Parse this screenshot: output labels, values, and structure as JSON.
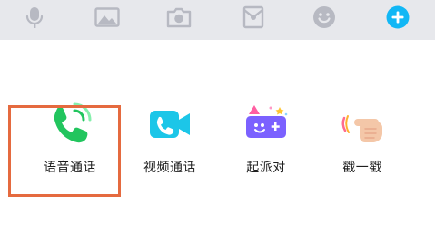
{
  "toolbar": {
    "items": [
      {
        "icon": "microphone-icon"
      },
      {
        "icon": "image-icon"
      },
      {
        "icon": "camera-icon"
      },
      {
        "icon": "red-packet-icon"
      },
      {
        "icon": "emoji-icon"
      },
      {
        "icon": "plus-icon"
      }
    ],
    "accent": "#12b7f5"
  },
  "apps": [
    {
      "label": "语音通话",
      "icon": "voice-call-icon",
      "selected": true
    },
    {
      "label": "视频通话",
      "icon": "video-call-icon",
      "selected": false
    },
    {
      "label": "起派对",
      "icon": "party-game-icon",
      "selected": false
    },
    {
      "label": "戳一戳",
      "icon": "poke-icon",
      "selected": false
    }
  ],
  "colors": {
    "highlight": "#e56a3f",
    "toolbar_bg": "#e7e8ec",
    "icon_gray": "#b7b9c2",
    "voice_green": "#22c55e",
    "video_cyan": "#1cc6e8",
    "party_purple": "#7b61ff"
  }
}
